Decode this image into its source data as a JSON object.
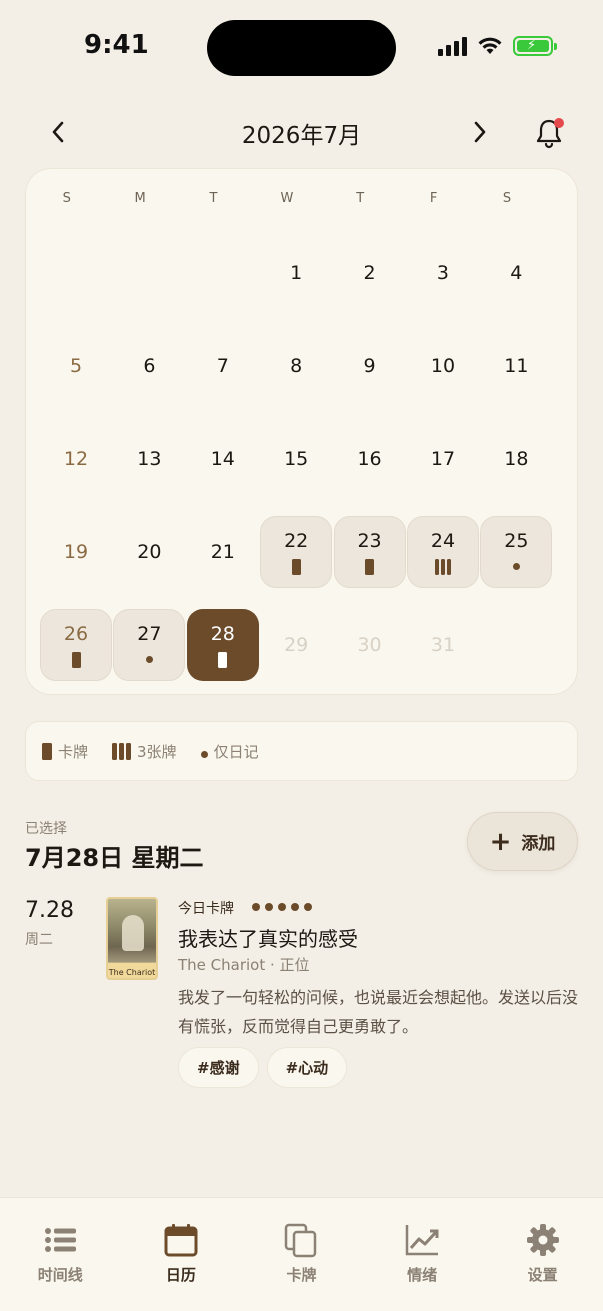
{
  "status_bar": {
    "time": "9:41"
  },
  "header": {
    "month_title": "2026年7月"
  },
  "calendar": {
    "weekdays": [
      "S",
      "M",
      "T",
      "W",
      "T",
      "F",
      "S"
    ],
    "days": [
      {
        "label": "",
        "state": "empty"
      },
      {
        "label": "",
        "state": "empty"
      },
      {
        "label": "",
        "state": "empty"
      },
      {
        "label": "1",
        "state": "normal"
      },
      {
        "label": "2",
        "state": "normal"
      },
      {
        "label": "3",
        "state": "normal"
      },
      {
        "label": "4",
        "state": "normal"
      },
      {
        "label": "5",
        "state": "sunday"
      },
      {
        "label": "6",
        "state": "normal"
      },
      {
        "label": "7",
        "state": "normal"
      },
      {
        "label": "8",
        "state": "normal"
      },
      {
        "label": "9",
        "state": "normal"
      },
      {
        "label": "10",
        "state": "normal"
      },
      {
        "label": "11",
        "state": "normal"
      },
      {
        "label": "12",
        "state": "sunday"
      },
      {
        "label": "13",
        "state": "normal"
      },
      {
        "label": "14",
        "state": "normal"
      },
      {
        "label": "15",
        "state": "normal"
      },
      {
        "label": "16",
        "state": "normal"
      },
      {
        "label": "17",
        "state": "normal"
      },
      {
        "label": "18",
        "state": "normal"
      },
      {
        "label": "19",
        "state": "sunday"
      },
      {
        "label": "20",
        "state": "normal"
      },
      {
        "label": "21",
        "state": "normal"
      },
      {
        "label": "22",
        "state": "has",
        "marker": "card"
      },
      {
        "label": "23",
        "state": "has",
        "marker": "card"
      },
      {
        "label": "24",
        "state": "has",
        "marker": "three"
      },
      {
        "label": "25",
        "state": "has",
        "marker": "diary"
      },
      {
        "label": "26",
        "state": "has-sunday",
        "marker": "card"
      },
      {
        "label": "27",
        "state": "has",
        "marker": "diary"
      },
      {
        "label": "28",
        "state": "selected",
        "marker": "card"
      },
      {
        "label": "29",
        "state": "future"
      },
      {
        "label": "30",
        "state": "future"
      },
      {
        "label": "31",
        "state": "future"
      }
    ]
  },
  "legend": {
    "card": "卡牌",
    "three": "3张牌",
    "diary": "仅日记"
  },
  "selection": {
    "label": "已选择",
    "date": "7月28日 星期二",
    "add_label": "添加"
  },
  "entry": {
    "date": "7.28",
    "weekday": "周二",
    "card_caption": "The Chariot",
    "today_label": "今日卡牌",
    "rating": 5,
    "title": "我表达了真实的感受",
    "card_name": "The Chariot · 正位",
    "body": "我发了一句轻松的问候，也说最近会想起他。发送以后没有慌张，反而觉得自己更勇敢了。",
    "tags": [
      "#感谢",
      "#心动"
    ]
  },
  "tabbar": {
    "items": [
      {
        "label": "时间线",
        "icon": "list-icon"
      },
      {
        "label": "日历",
        "icon": "calendar-icon",
        "active": true
      },
      {
        "label": "卡牌",
        "icon": "cards-icon"
      },
      {
        "label": "情绪",
        "icon": "chart-icon"
      },
      {
        "label": "设置",
        "icon": "gear-icon"
      }
    ]
  },
  "colors": {
    "accent": "#6b4b2a",
    "background": "#f3efe6",
    "notification": "#e5484d"
  }
}
